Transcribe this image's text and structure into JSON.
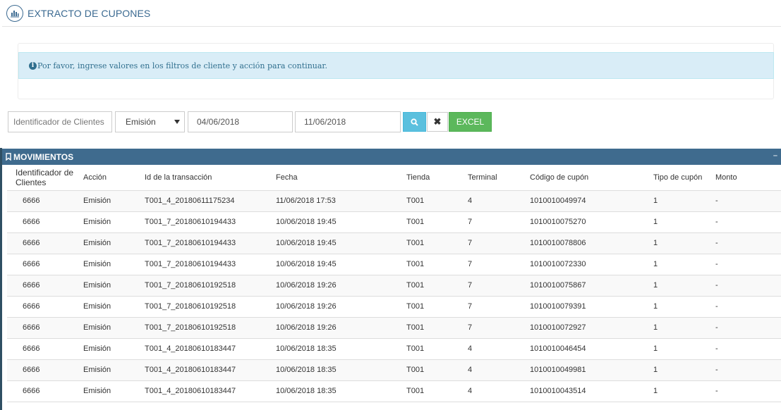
{
  "header": {
    "title": "EXTRACTO DE CUPONES",
    "icon": "bar-chart-icon"
  },
  "alert": {
    "message": "Por favor, ingrese valores en los filtros de cliente y acción para continuar."
  },
  "filters": {
    "client_placeholder": "Identificador de Clientes",
    "client_value": "",
    "action_selected": "Emisión",
    "date_from": "04/06/2018",
    "date_to": "11/06/2018",
    "excel_label": "EXCEL"
  },
  "panel": {
    "title": "MOVIMIENTOS",
    "collapse": "–"
  },
  "table": {
    "headers": [
      "Identificador de Clientes",
      "Acción",
      "Id de la transacción",
      "Fecha",
      "Tienda",
      "Terminal",
      "Código de cupón",
      "Tipo de cupón",
      "Monto"
    ],
    "rows": [
      [
        "6666",
        "Emisión",
        "T001_4_20180611175234",
        "11/06/2018 17:53",
        "T001",
        "4",
        "1010010049974",
        "1",
        "-"
      ],
      [
        "6666",
        "Emisión",
        "T001_7_20180610194433",
        "10/06/2018 19:45",
        "T001",
        "7",
        "1010010075270",
        "1",
        "-"
      ],
      [
        "6666",
        "Emisión",
        "T001_7_20180610194433",
        "10/06/2018 19:45",
        "T001",
        "7",
        "1010010078806",
        "1",
        "-"
      ],
      [
        "6666",
        "Emisión",
        "T001_7_20180610194433",
        "10/06/2018 19:45",
        "T001",
        "7",
        "1010010072330",
        "1",
        "-"
      ],
      [
        "6666",
        "Emisión",
        "T001_7_20180610192518",
        "10/06/2018 19:26",
        "T001",
        "7",
        "1010010075867",
        "1",
        "-"
      ],
      [
        "6666",
        "Emisión",
        "T001_7_20180610192518",
        "10/06/2018 19:26",
        "T001",
        "7",
        "1010010079391",
        "1",
        "-"
      ],
      [
        "6666",
        "Emisión",
        "T001_7_20180610192518",
        "10/06/2018 19:26",
        "T001",
        "7",
        "1010010072927",
        "1",
        "-"
      ],
      [
        "6666",
        "Emisión",
        "T001_4_20180610183447",
        "10/06/2018 18:35",
        "T001",
        "4",
        "1010010046454",
        "1",
        "-"
      ],
      [
        "6666",
        "Emisión",
        "T001_4_20180610183447",
        "10/06/2018 18:35",
        "T001",
        "4",
        "1010010049981",
        "1",
        "-"
      ],
      [
        "6666",
        "Emisión",
        "T001_4_20180610183447",
        "10/06/2018 18:35",
        "T001",
        "4",
        "1010010043514",
        "1",
        "-"
      ]
    ]
  },
  "colors": {
    "header_text": "#3b6a91",
    "panel_bg": "#3f6b8e",
    "info_bg": "#d9edf7",
    "search_btn": "#5bc0de",
    "excel_btn": "#5cb85c"
  }
}
